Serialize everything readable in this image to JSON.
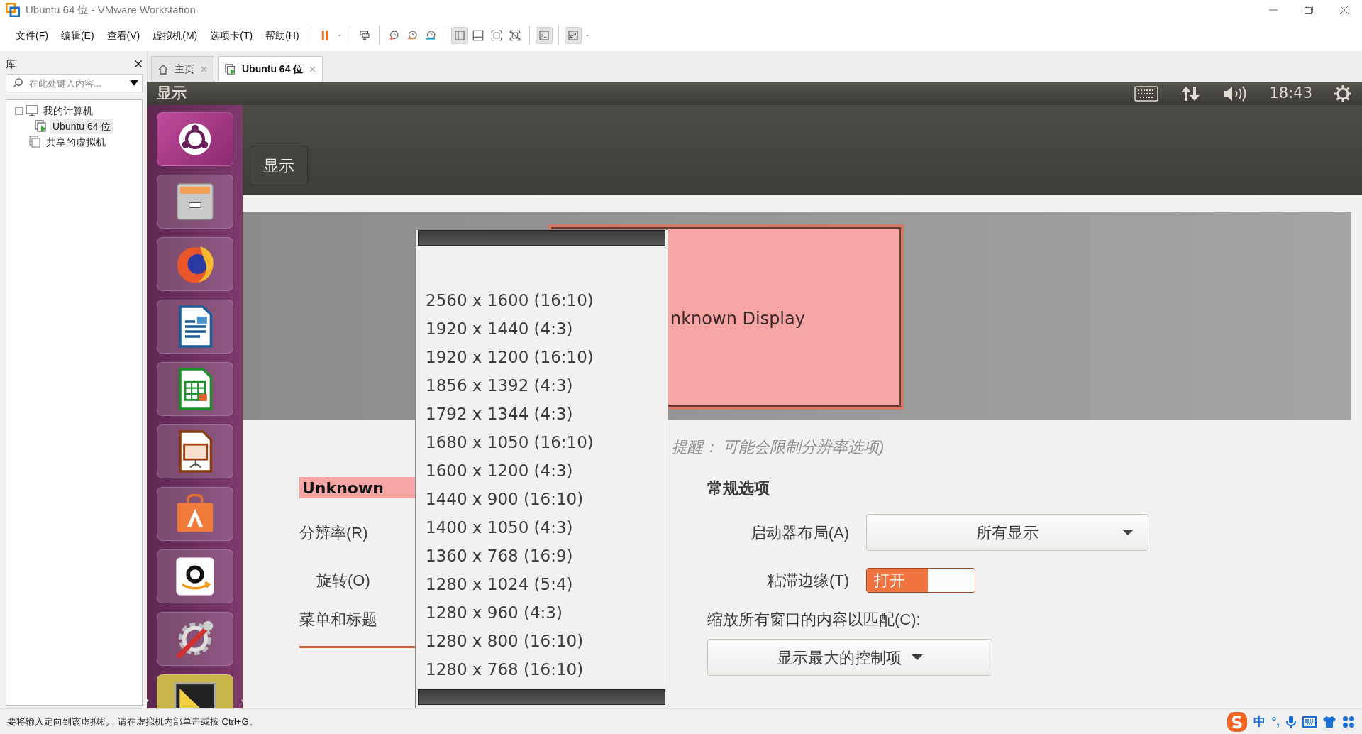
{
  "window": {
    "title": "Ubuntu 64 位 - VMware Workstation"
  },
  "menu": [
    "文件(F)",
    "编辑(E)",
    "查看(V)",
    "虚拟机(M)",
    "选项卡(T)",
    "帮助(H)"
  ],
  "library": {
    "title": "库",
    "search": {
      "placeholder": "在此处键入内容..."
    },
    "tree": [
      {
        "label": "我的计算机",
        "kind": "computer",
        "expanded": true,
        "selected": false,
        "children": [
          {
            "label": "Ubuntu 64 位",
            "kind": "vm",
            "selected": true
          }
        ]
      },
      {
        "label": "共享的虚拟机",
        "kind": "shared",
        "selected": false
      }
    ]
  },
  "tabs": [
    {
      "label": "主页",
      "kind": "home",
      "selected": false
    },
    {
      "label": "Ubuntu 64 位",
      "kind": "vm",
      "selected": true
    }
  ],
  "guest": {
    "panel": {
      "title": "显示",
      "clock": "18:43"
    },
    "launcher": [
      {
        "kind": "dash",
        "focused": false
      },
      {
        "kind": "files",
        "focused": false
      },
      {
        "kind": "browser",
        "focused": false
      },
      {
        "kind": "writer",
        "focused": false
      },
      {
        "kind": "calc",
        "focused": false
      },
      {
        "kind": "impress",
        "focused": false
      },
      {
        "kind": "software",
        "focused": false
      },
      {
        "kind": "store",
        "focused": false
      },
      {
        "kind": "settings",
        "focused": false
      },
      {
        "kind": "display",
        "focused": true
      }
    ],
    "settings": {
      "header_button": "显示",
      "monitor_label": "nknown Display",
      "hint": "提醒： 可能会限制分辨率选项)",
      "display_name": "Unknown",
      "resolution_label": "分辨率(R)",
      "rotation_label": "旋转(O)",
      "menu_label": "菜单和标题",
      "general": {
        "title": "常规选项",
        "launcher_label": "启动器布局(A)",
        "launcher_value": "所有显示",
        "sticky_label": "粘滞边缘(T)",
        "sticky": {
          "on": true,
          "label": "打开"
        },
        "scale_label": "缩放所有窗口的内容以匹配(C):",
        "scale_value": "显示最大的控制项"
      }
    },
    "resolution_menu": [
      "2560 x 1600 (16:10)",
      "1920 x 1440 (4:3)",
      "1920 x 1200 (16:10)",
      "1856 x 1392 (4:3)",
      "1792 x 1344 (4:3)",
      "1680 x 1050 (16:10)",
      "1600 x 1200 (4:3)",
      "1440 x 900 (16:10)",
      "1400 x 1050 (4:3)",
      "1360 x 768 (16:9)",
      "1280 x 1024 (5:4)",
      "1280 x 960 (4:3)",
      "1280 x 800 (16:10)",
      "1280 x 768 (16:10)"
    ]
  },
  "status_bar": {
    "text": "要将输入定向到该虚拟机，请在虚拟机内部单击或按 Ctrl+G。",
    "tray": [
      "中",
      "°,"
    ]
  }
}
